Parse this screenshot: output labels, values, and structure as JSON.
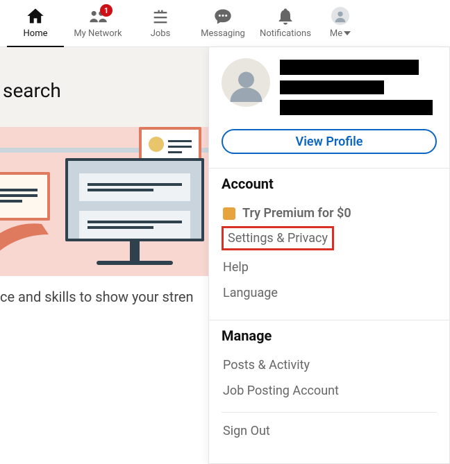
{
  "nav": {
    "items": [
      {
        "label": "Home",
        "icon": "home"
      },
      {
        "label": "My Network",
        "icon": "people",
        "badge": 1
      },
      {
        "label": "Jobs",
        "icon": "briefcase"
      },
      {
        "label": "Messaging",
        "icon": "message"
      },
      {
        "label": "Notifications",
        "icon": "bell"
      }
    ],
    "me_label": "Me"
  },
  "background": {
    "search_label": "search",
    "caption": "ce and skills to show your stren"
  },
  "dropdown": {
    "view_profile": "View Profile",
    "account_heading": "Account",
    "premium_label": "Try Premium for $0",
    "settings_label": "Settings & Privacy",
    "help_label": "Help",
    "language_label": "Language",
    "manage_heading": "Manage",
    "posts_label": "Posts & Activity",
    "job_posting_label": "Job Posting Account",
    "signout_label": "Sign Out"
  }
}
